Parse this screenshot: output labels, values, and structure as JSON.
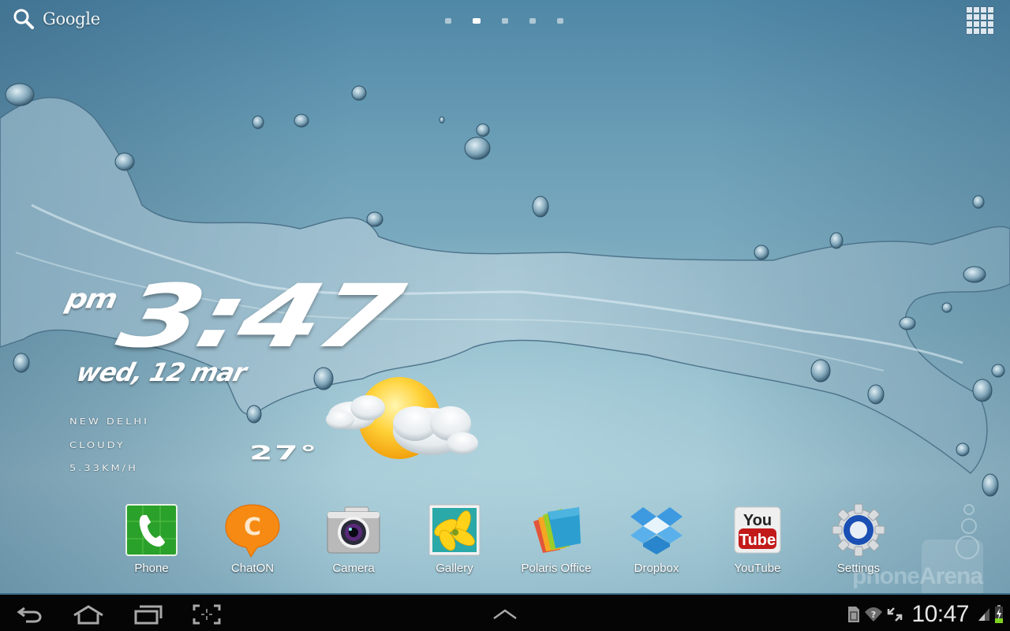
{
  "topbar": {
    "search_label": "Google",
    "pages": {
      "count": 5,
      "current_index": 1
    },
    "apps_button": "all-apps"
  },
  "clock": {
    "ampm": "pm",
    "time": "3:47",
    "date": "wed, 12 mar"
  },
  "weather": {
    "city": "New Delhi",
    "condition": "Cloudy",
    "wind": "5.33km/h",
    "temperature": "27°",
    "icon": "partly-cloudy-icon"
  },
  "dock": {
    "apps": [
      {
        "label": "Phone",
        "icon": "phone-icon"
      },
      {
        "label": "ChatON",
        "icon": "chaton-icon"
      },
      {
        "label": "Camera",
        "icon": "camera-icon"
      },
      {
        "label": "Gallery",
        "icon": "gallery-icon"
      },
      {
        "label": "Polaris Office",
        "icon": "polaris-office-icon"
      },
      {
        "label": "Dropbox",
        "icon": "dropbox-icon"
      },
      {
        "label": "YouTube",
        "icon": "youtube-icon"
      },
      {
        "label": "Settings",
        "icon": "settings-icon"
      }
    ]
  },
  "watermark": {
    "text": "phoneArena"
  },
  "navbar": {
    "buttons": [
      "back",
      "home",
      "recent-apps",
      "screenshot"
    ],
    "center": "expand-up",
    "status": {
      "time": "10:47",
      "icons": [
        "sd-card-icon",
        "wifi-unknown-icon",
        "sync-icon",
        "signal-icon",
        "battery-charging-icon"
      ]
    }
  },
  "colors": {
    "wallpaper_top": "#4f87a6",
    "wallpaper_bottom": "#a3c8d4",
    "navbar_bg": "#050505",
    "navbar_border": "#3b6f87",
    "battery_green": "#7ed321"
  }
}
